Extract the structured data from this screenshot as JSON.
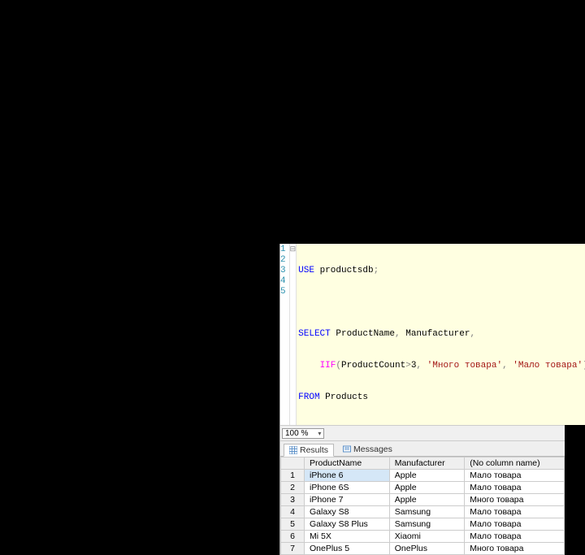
{
  "editor": {
    "line_numbers": [
      "1",
      "2",
      "3",
      "4",
      "5"
    ],
    "fold_marks": [
      "⊟",
      "",
      "",
      "",
      ""
    ],
    "code": {
      "l1": {
        "kw_use": "USE",
        "db": "productsdb",
        "semi": ";"
      },
      "l3": {
        "kw_select": "SELECT",
        "cols": "ProductName",
        "comma1": ",",
        "col2": "Manufacturer",
        "comma2": ","
      },
      "l4": {
        "fn": "IIF",
        "open": "(",
        "arg": "ProductCount",
        "gt": ">",
        "num": "3",
        "c1": ",",
        "s1": "'Много товара'",
        "c2": ",",
        "s2": "'Мало товара'",
        "close": ")"
      },
      "l5": {
        "kw_from": "FROM",
        "tbl": "Products"
      }
    }
  },
  "zoom": {
    "value": "100 %"
  },
  "tabs": {
    "results": "Results",
    "messages": "Messages"
  },
  "grid": {
    "headers": [
      "ProductName",
      "Manufacturer",
      "(No column name)"
    ],
    "rows": [
      {
        "n": "1",
        "c": [
          "iPhone 6",
          "Apple",
          "Мало товара"
        ],
        "selected": true
      },
      {
        "n": "2",
        "c": [
          "iPhone 6S",
          "Apple",
          "Мало товара"
        ]
      },
      {
        "n": "3",
        "c": [
          "iPhone 7",
          "Apple",
          "Много товара"
        ]
      },
      {
        "n": "4",
        "c": [
          "Galaxy S8",
          "Samsung",
          "Мало товара"
        ]
      },
      {
        "n": "5",
        "c": [
          "Galaxy S8 Plus",
          "Samsung",
          "Мало товара"
        ]
      },
      {
        "n": "6",
        "c": [
          "Mi 5X",
          "Xiaomi",
          "Мало товара"
        ]
      },
      {
        "n": "7",
        "c": [
          "OnePlus 5",
          "OnePlus",
          "Много товара"
        ]
      }
    ]
  }
}
